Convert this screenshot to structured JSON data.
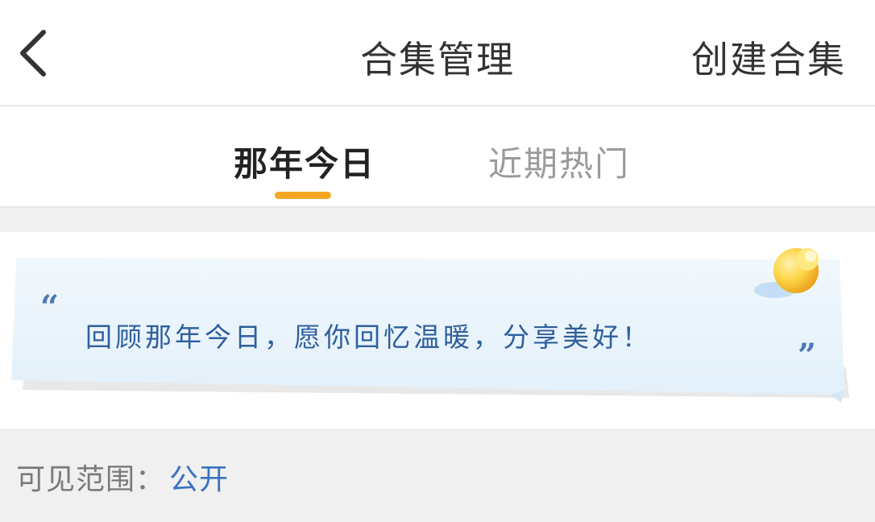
{
  "header": {
    "title": "合集管理",
    "create_label": "创建合集"
  },
  "tabs": [
    {
      "label": "那年今日",
      "active": true
    },
    {
      "label": "近期热门",
      "active": false
    }
  ],
  "banner": {
    "quote_open": "“",
    "text": "回顾那年今日，愿你回忆温暖，分享美好！",
    "quote_close": "”"
  },
  "visibility": {
    "label": "可见范围：",
    "value": "公开"
  },
  "colors": {
    "accent": "#f5a623",
    "link": "#3b73c0",
    "banner_text": "#2f5f9e"
  },
  "icons": {
    "back": "chevron-left-icon",
    "pin": "pushpin-icon"
  }
}
